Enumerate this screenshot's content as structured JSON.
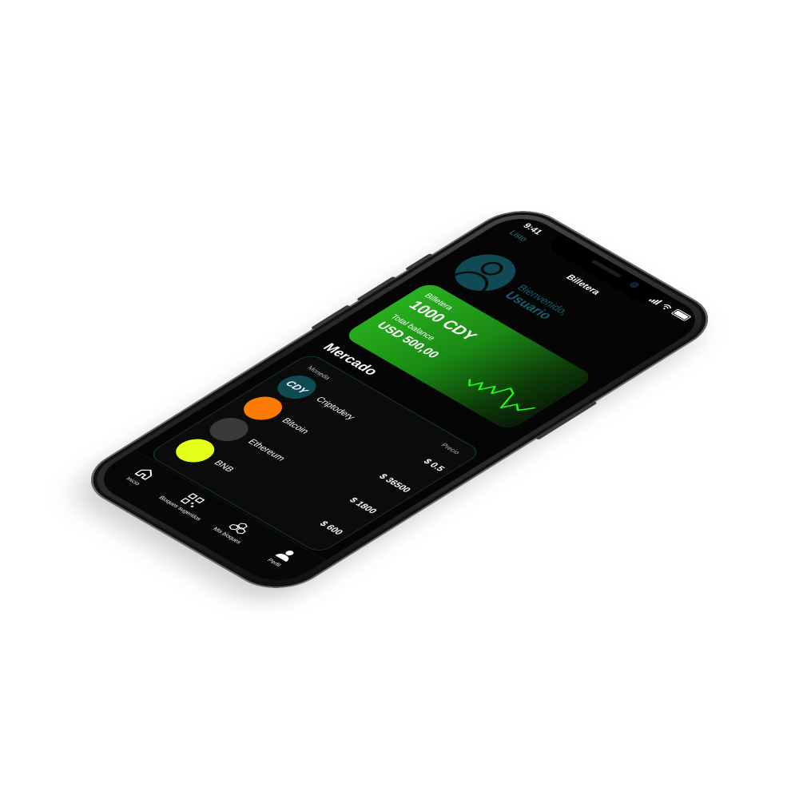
{
  "status_bar": {
    "time": "9:41"
  },
  "header": {
    "back_label": "Listo",
    "title": "Billetera"
  },
  "profile": {
    "greeting": "Bienvenido,",
    "user_name": "Usuario"
  },
  "wallet": {
    "label": "Billetera",
    "amount": "1000 CDY",
    "balance_label": "Total balance",
    "balance_amount": "USD 500,00"
  },
  "market": {
    "title": "Mercado",
    "col_coin": "Moneda",
    "col_price": "Precio",
    "coins": [
      {
        "name": "Criptodery",
        "logo": "CDY",
        "price": "$ 0.5",
        "color": "#0f4a55"
      },
      {
        "name": "Bitcoin",
        "logo": "",
        "price": "$ 36500",
        "color": "#ff7a00"
      },
      {
        "name": "Ethereum",
        "logo": "",
        "price": "$ 1800",
        "color": "#3a3a3a"
      },
      {
        "name": "BNB",
        "logo": "",
        "price": "$ 600",
        "color": "#e4ff1a"
      }
    ]
  },
  "tabs": [
    {
      "label": "Inicio",
      "icon": "home-icon"
    },
    {
      "label": "Bloques sugeridos",
      "icon": "qr-icon"
    },
    {
      "label": "Mis bloques",
      "icon": "blocks-icon"
    },
    {
      "label": "Perfil",
      "icon": "user-icon"
    }
  ],
  "colors": {
    "accent_green": "#29b21f",
    "teal": "#0f4a55",
    "screen_bg": "#050505"
  }
}
